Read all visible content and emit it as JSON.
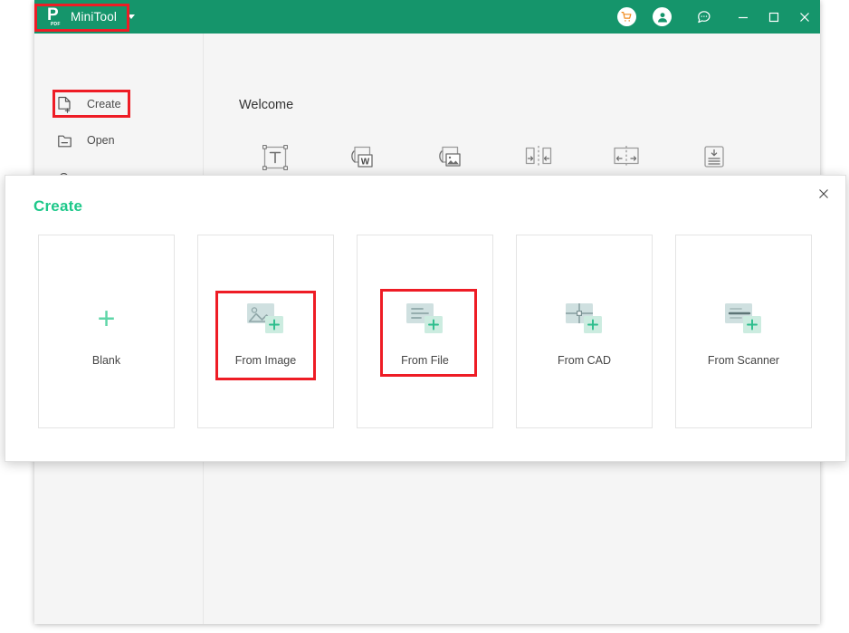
{
  "window": {
    "titlebar": {
      "brand_name": "MiniTool",
      "logo_letter": "P",
      "logo_sub": "PDF",
      "brand_color": "#15956b",
      "caret_icon": "chevron-down-icon",
      "cart_icon": "shopping-cart-icon",
      "account_icon": "user-account-icon",
      "chat_icon": "chat-bubble-icon",
      "minimize_icon": "minimize-icon",
      "maximize_icon": "maximize-icon",
      "close_icon": "close-icon"
    },
    "sidebar": {
      "items": [
        {
          "label": "Create",
          "icon": "document-plus-icon"
        },
        {
          "label": "Open",
          "icon": "folder-open-icon"
        },
        {
          "label": "",
          "icon": "cloud-icon"
        }
      ]
    },
    "content": {
      "welcome_title": "Welcome",
      "quick_actions": [
        {
          "label": "",
          "icon": "text-tool-icon"
        },
        {
          "label": "",
          "icon": "pdf-to-word-icon"
        },
        {
          "label": "",
          "icon": "pdf-to-image-icon"
        },
        {
          "label": "",
          "icon": "merge-pdf-icon"
        },
        {
          "label": "",
          "icon": "split-pdf-icon"
        },
        {
          "label": "",
          "icon": "compress-pdf-icon"
        }
      ]
    }
  },
  "dialog": {
    "title": "Create",
    "title_color": "#1ec88a",
    "close_icon": "close-icon",
    "cards": [
      {
        "label": "Blank",
        "icon": "plus-icon",
        "highlighted": false
      },
      {
        "label": "From Image",
        "icon": "image-plus-icon",
        "highlighted": true
      },
      {
        "label": "From File",
        "icon": "file-plus-icon",
        "highlighted": true
      },
      {
        "label": "From CAD",
        "icon": "cad-plus-icon",
        "highlighted": false
      },
      {
        "label": "From Scanner",
        "icon": "scanner-plus-icon",
        "highlighted": false
      }
    ]
  },
  "annotations": {
    "color": "#ee1c25",
    "boxes": [
      {
        "target": "brand-menu"
      },
      {
        "target": "sidebar-item-create"
      },
      {
        "target": "create-card-from-image"
      },
      {
        "target": "create-card-from-file"
      }
    ]
  }
}
